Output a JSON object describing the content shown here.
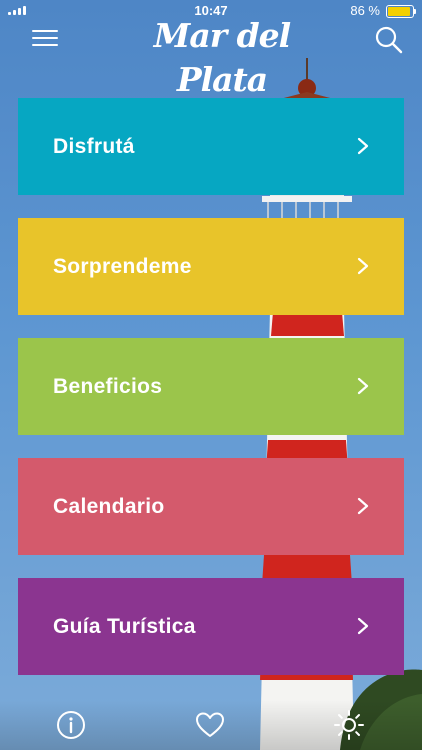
{
  "status_bar": {
    "time": "10:47",
    "battery_text": "86 %",
    "battery_level": 0.86,
    "battery_color": "#f4d000"
  },
  "header": {
    "logo_text": "Mar del Plata",
    "menu_icon": "hamburger-menu-icon",
    "search_icon": "search-icon"
  },
  "menu": {
    "items": [
      {
        "label": "Disfrutá",
        "color": "#06a7c2"
      },
      {
        "label": "Sorprendeme",
        "color": "#e8c42a"
      },
      {
        "label": "Beneficios",
        "color": "#9bc54b"
      },
      {
        "label": "Calendario",
        "color": "#d45a6c"
      },
      {
        "label": "Guía Turística",
        "color": "#8b3590"
      }
    ],
    "chevron_icon": "chevron-right-icon"
  },
  "bottom_bar": {
    "icons": [
      "info-icon",
      "heart-icon",
      "sun-icon"
    ]
  }
}
